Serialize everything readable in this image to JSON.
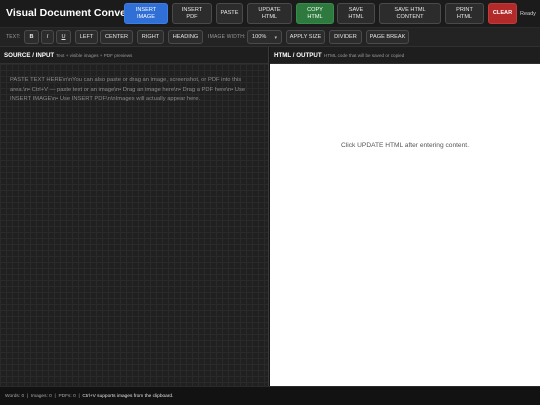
{
  "header": {
    "title": "Visual Document Converter",
    "buttons": {
      "insert_image": "INSERT\nIMAGE",
      "insert_pdf": "INSERT\nPDF",
      "paste": "PASTE",
      "update_html": "UPDATE\nHTML",
      "copy_html": "COPY\nHTML",
      "save_html": "SAVE\nHTML",
      "save_html_content": "SAVE HTML\nCONTENT",
      "print_html": "PRINT\nHTML",
      "clear": "CLEAR"
    },
    "status": "Ready"
  },
  "toolbar": {
    "text_label": "TEXT:",
    "bold": "B",
    "italic": "I",
    "underline": "U",
    "left": "LEFT",
    "center": "CENTER",
    "right": "RIGHT",
    "heading": "HEADING",
    "image_width_label": "IMAGE WIDTH:",
    "image_width_value": "100%",
    "apply_size": "APPLY SIZE",
    "divider": "DIVIDER",
    "page_break": "PAGE BREAK"
  },
  "source": {
    "title": "SOURCE / INPUT",
    "subtitle": "Text + visible images + PDF previews",
    "placeholder": "PASTE TEXT HERE\\n\\nYou can also paste or drag an image, screenshot, or PDF into this area.\\n• Ctrl+V — paste text or an image\\n• Drag an image here\\n• Drag a PDF here\\n• Use INSERT IMAGE\\n• Use INSERT PDF\\n\\nImages will actually appear here."
  },
  "output": {
    "title": "HTML / OUTPUT",
    "subtitle": "HTML code that will be saved or copied",
    "empty_message": "Click UPDATE HTML after entering content."
  },
  "footer": {
    "words": "Words: 0",
    "images": "Images: 0",
    "pdfs": "PDFs: 0",
    "separator": "|",
    "hint": "Ctrl+V supports images from the clipboard."
  },
  "colors": {
    "accent_blue": "#2f6fd6",
    "accent_green": "#2e7a3e",
    "accent_red": "#b32a2a",
    "background": "#161616"
  }
}
